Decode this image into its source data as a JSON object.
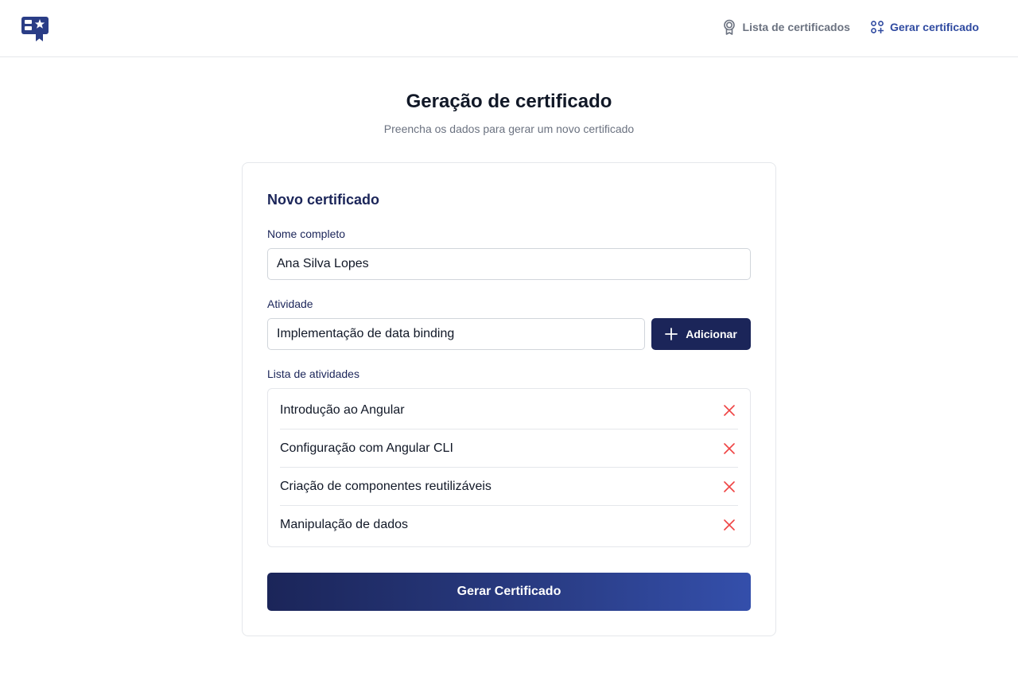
{
  "header": {
    "logo_icon": "certificate-logo-icon",
    "nav": [
      {
        "label": "Lista de certificados",
        "icon": "award-icon",
        "active": false
      },
      {
        "label": "Gerar certificado",
        "icon": "grid-plus-icon",
        "active": true
      }
    ]
  },
  "page": {
    "title": "Geração de certificado",
    "subtitle": "Preencha os dados para gerar um novo certificado"
  },
  "form": {
    "card_title": "Novo certificado",
    "name_label": "Nome completo",
    "name_value": "Ana Silva Lopes",
    "activity_label": "Atividade",
    "activity_value": "Implementação de data binding",
    "add_button_label": "Adicionar",
    "add_button_icon": "plus-icon",
    "list_label": "Lista de atividades",
    "activities": [
      "Introdução ao Angular",
      "Configuração com Angular CLI",
      "Criação de componentes reutilizáveis",
      "Manipulação de dados"
    ],
    "remove_icon": "close-icon",
    "submit_label": "Gerar Certificado"
  },
  "colors": {
    "primary": "#1b2559",
    "accent": "#2f4aa0",
    "danger": "#ef4444",
    "muted": "#6b7280",
    "border": "#e5e7eb"
  }
}
